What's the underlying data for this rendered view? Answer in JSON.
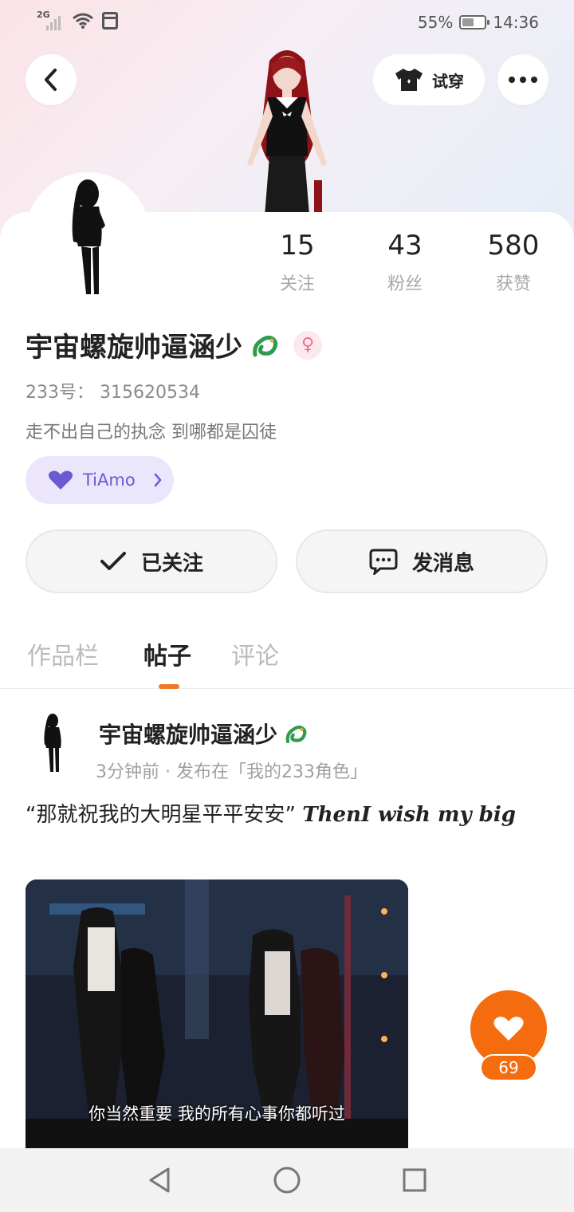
{
  "status_bar": {
    "signal_label": "2G",
    "battery_text": "55%",
    "battery_level": 0.55,
    "time": "14:36"
  },
  "header": {
    "back_icon": "chevron-left-icon",
    "tryon_label": "试穿",
    "tryon_icon": "shirt-icon",
    "more_icon": "more-dots-icon"
  },
  "profile": {
    "stats": [
      {
        "value": "15",
        "label": "关注"
      },
      {
        "value": "43",
        "label": "粉丝"
      },
      {
        "value": "580",
        "label": "获赞"
      }
    ],
    "username": "宇宙螺旋帅逼涵少",
    "badge_icon": "dragon-icon",
    "gender_symbol": "♀",
    "uid_text": "233号： 315620534",
    "bio": "走不出自己的执念 到哪都是囚徒",
    "tag_label": "TiAmo",
    "tag_icon": "heart-icon",
    "follow_label": "已关注",
    "message_label": "发消息"
  },
  "tabs": [
    {
      "label": "作品栏",
      "active": false
    },
    {
      "label": "帖子",
      "active": true
    },
    {
      "label": "评论",
      "active": false
    }
  ],
  "post": {
    "author": "宇宙螺旋帅逼涵少",
    "meta": "3分钟前 · 发布在「我的233角色」",
    "text_cn": "“那就祝我的大明星平平安安”",
    "text_en": "ThenI wish my big",
    "image_subtitle": "你当然重要 我的所有心事你都听过",
    "like_count": "69"
  },
  "colors": {
    "accent_orange": "#f56c0e",
    "tag_purple": "#6b5bd1",
    "gender_pink": "#f06e94"
  }
}
